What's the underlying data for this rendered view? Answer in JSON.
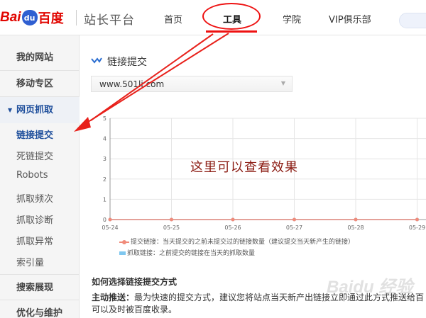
{
  "header": {
    "logo": {
      "text_bai": "Bai",
      "text_du": "du",
      "text_cn": "百度"
    },
    "site_title": "站长平台",
    "nav": [
      "首页",
      "工具",
      "学院",
      "VIP俱乐部"
    ]
  },
  "sidebar": {
    "sections": [
      {
        "label": "我的网站"
      },
      {
        "label": "移动专区"
      },
      {
        "label": "网页抓取"
      },
      {
        "label": "搜索展现"
      },
      {
        "label": "优化与维护"
      }
    ],
    "items": [
      "链接提交",
      "死链提交",
      "Robots",
      "抓取频次",
      "抓取诊断",
      "抓取异常",
      "索引量"
    ]
  },
  "main": {
    "title": "链接提交",
    "site_select": "www.501li.com",
    "annotation": "这里可以查看效果",
    "legend": [
      "提交链接：当天提交的之前未提交过的链接数量（建议提交当天新产生的链接）",
      "抓取链接：之前提交的链接在当天的抓取数量"
    ],
    "how_title": "如何选择链接提交方式",
    "para_lead": "主动推送：",
    "para_rest": "最为快速的提交方式，建议您将站点当天新产出链接立即通过此方式推送给百",
    "para_line2": "可以及时被百度收录。"
  },
  "chart_data": {
    "type": "line",
    "x": [
      "05-24",
      "05-25",
      "05-26",
      "05-27",
      "05-28",
      "05-29"
    ],
    "ylim": [
      0,
      5
    ],
    "yticks": [
      0,
      1,
      2,
      3,
      4,
      5
    ],
    "grid": true,
    "legend": "bottom",
    "series": [
      {
        "name": "提交链接",
        "values": [
          0,
          0,
          0,
          0,
          0,
          0
        ],
        "color": "#f08b7a"
      },
      {
        "name": "抓取链接",
        "values": [
          0,
          0,
          0,
          0,
          0,
          0
        ],
        "color": "#7fc7ef"
      }
    ]
  },
  "watermark": "Baidu 经验"
}
